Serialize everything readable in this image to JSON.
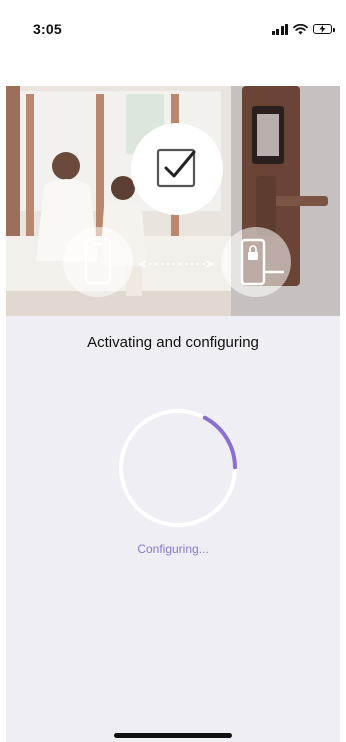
{
  "status_bar": {
    "time": "3:05"
  },
  "hero": {
    "center_icon": "checkbox-icon",
    "left_icon": "smartphone-icon",
    "right_icon": "lock-icon",
    "link_icon": "dotted-arrow-icon"
  },
  "main": {
    "title": "Activating and configuring",
    "progress_label": "Configuring...",
    "progress_fraction": 0.17
  },
  "colors": {
    "accent": "#8a6fd1",
    "progress_text": "#8a78c6",
    "background": "#efeef4"
  }
}
